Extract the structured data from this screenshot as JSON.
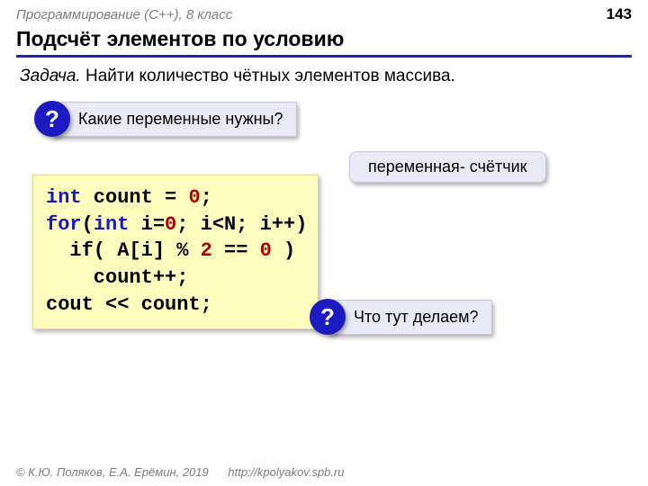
{
  "header": {
    "course": "Программирование (C++), 8 класс",
    "page": "143"
  },
  "title": "Подсчёт элементов по условию",
  "task": {
    "label": "Задача.",
    "text": " Найти количество чётных элементов массива."
  },
  "callout1": {
    "mark": "?",
    "text": "Какие переменные нужны?"
  },
  "annotation": "переменная-\nсчётчик",
  "code": {
    "l1a": "int",
    "l1b": " count = ",
    "l1c": "0",
    "l1d": ";",
    "l2a": "for",
    "l2b": "(",
    "l2c": "int",
    "l2d": " i=",
    "l2e": "0",
    "l2f": "; i<N; i++)",
    "l3a": "  if( A[i] % ",
    "l3b": "2",
    "l3c": " == ",
    "l3d": "0",
    "l3e": " )",
    "l4": "    count++;",
    "l5": "cout << count;"
  },
  "callout2": {
    "mark": "?",
    "text": "Что тут делаем?"
  },
  "footer": {
    "copyright": "© К.Ю. Поляков, Е.А. Ерёмин, 2019",
    "link": "http://kpolyakov.spb.ru"
  }
}
